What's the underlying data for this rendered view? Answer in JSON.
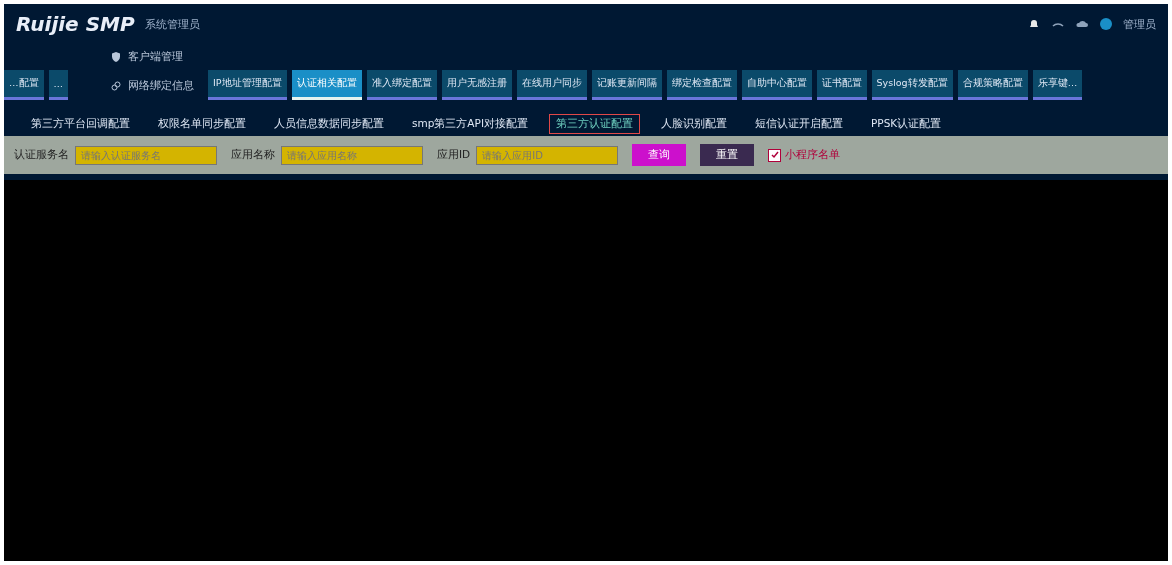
{
  "header": {
    "logo": "Ruijie SMP",
    "subtitle": "系统管理员",
    "user": "管理员"
  },
  "menu": {
    "items": [
      {
        "label": "客户端管理"
      },
      {
        "label": "网络绑定信息"
      }
    ]
  },
  "tabs": [
    {
      "label": "…配置",
      "selected": false
    },
    {
      "label": "…",
      "selected": false
    },
    {
      "label": "IP地址管理配置",
      "selected": false
    },
    {
      "label": "认证相关配置",
      "selected": true
    },
    {
      "label": "准入绑定配置",
      "selected": false
    },
    {
      "label": "用户无感注册",
      "selected": false
    },
    {
      "label": "在线用户同步",
      "selected": false
    },
    {
      "label": "记账更新间隔",
      "selected": false
    },
    {
      "label": "绑定检查配置",
      "selected": false
    },
    {
      "label": "自助中心配置",
      "selected": false
    },
    {
      "label": "证书配置",
      "selected": false
    },
    {
      "label": "Syslog转发配置",
      "selected": false
    },
    {
      "label": "合规策略配置",
      "selected": false
    },
    {
      "label": "乐享键…",
      "selected": false
    }
  ],
  "subtabs": [
    {
      "label": "第三方平台回调配置",
      "selected": false
    },
    {
      "label": "权限名单同步配置",
      "selected": false
    },
    {
      "label": "人员信息数据同步配置",
      "selected": false
    },
    {
      "label": "smp第三方API对接配置",
      "selected": false
    },
    {
      "label": "第三方认证配置",
      "selected": true
    },
    {
      "label": "人脸识别配置",
      "selected": false
    },
    {
      "label": "短信认证开启配置",
      "selected": false
    },
    {
      "label": "PPSK认证配置",
      "selected": false
    }
  ],
  "filters": {
    "fields": [
      {
        "label": "认证服务名",
        "placeholder": "请输入认证服务名"
      },
      {
        "label": "应用名称",
        "placeholder": "请输入应用名称"
      },
      {
        "label": "应用ID",
        "placeholder": "请输入应用ID"
      }
    ],
    "search_button": "查询",
    "reset_button": "重置",
    "mini_program": {
      "label": "小程序名单",
      "checked": true
    }
  }
}
